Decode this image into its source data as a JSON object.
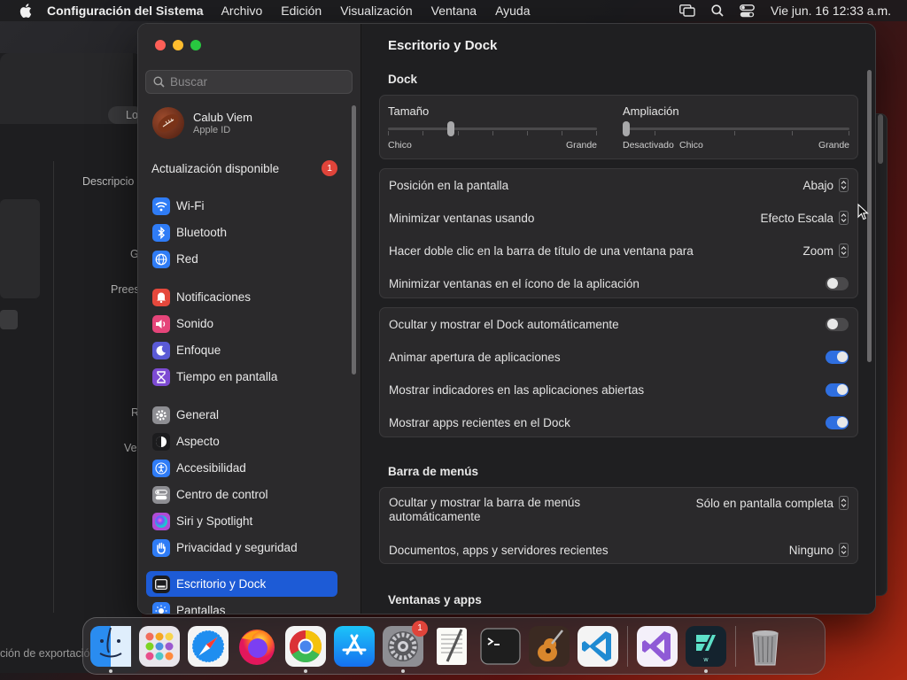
{
  "menubar": {
    "app_name": "Configuración del Sistema",
    "menus": [
      "Archivo",
      "Edición",
      "Visualización",
      "Ventana",
      "Ayuda"
    ],
    "datetime": "Vie jun. 16  12:33 a.m.",
    "icons": [
      "apple-logo-icon",
      "screen-mirroring-icon",
      "search-icon",
      "control-center-icon"
    ]
  },
  "background": {
    "texts": [
      "Lo",
      "Descripcio",
      "G",
      "Prees",
      "R",
      "Ve",
      "ción de exportació"
    ]
  },
  "sidebar": {
    "search_placeholder": "Buscar",
    "profile": {
      "name": "Calub Viem",
      "subtitle": "Apple ID"
    },
    "update": {
      "label": "Actualización disponible",
      "badge": "1"
    },
    "items": [
      {
        "label": "Wi-Fi",
        "icon": "wifi-icon",
        "color": "#2f7cf6"
      },
      {
        "label": "Bluetooth",
        "icon": "bluetooth-icon",
        "color": "#2f7cf6"
      },
      {
        "label": "Red",
        "icon": "globe-icon",
        "color": "#2f7cf6"
      },
      {
        "label": "Notificaciones",
        "icon": "bell-icon",
        "color": "#e5483c"
      },
      {
        "label": "Sonido",
        "icon": "speaker-icon",
        "color": "#e5457a"
      },
      {
        "label": "Enfoque",
        "icon": "moon-icon",
        "color": "#5a5ad6"
      },
      {
        "label": "Tiempo en pantalla",
        "icon": "hourglass-icon",
        "color": "#7d4bd3"
      },
      {
        "label": "General",
        "icon": "gear-icon",
        "color": "#8e8e93"
      },
      {
        "label": "Aspecto",
        "icon": "appearance-icon",
        "color": "#1c1c1e"
      },
      {
        "label": "Accesibilidad",
        "icon": "accessibility-icon",
        "color": "#2f7cf6"
      },
      {
        "label": "Centro de control",
        "icon": "control-center-icon",
        "color": "#8e8e93"
      },
      {
        "label": "Siri y Spotlight",
        "icon": "siri-icon",
        "color": "#b04bd6"
      },
      {
        "label": "Privacidad y seguridad",
        "icon": "hand-icon",
        "color": "#2f7cf6"
      },
      {
        "label": "Escritorio y Dock",
        "icon": "dock-icon",
        "color": "#1c1c1e",
        "active": true
      },
      {
        "label": "Pantallas",
        "icon": "sun-icon",
        "color": "#2f7cf6"
      }
    ]
  },
  "content": {
    "title": "Escritorio y Dock",
    "dock_section": "Dock",
    "size_slider": {
      "label": "Tamaño",
      "min_label": "Chico",
      "max_label": "Grande",
      "value": 0.3
    },
    "magnification_slider": {
      "label": "Ampliación",
      "off_label": "Desactivado",
      "min_label": "Chico",
      "max_label": "Grande",
      "value": 0.0
    },
    "dock_options": [
      {
        "label": "Posición en la pantalla",
        "value": "Abajo",
        "type": "popup"
      },
      {
        "label": "Minimizar ventanas usando",
        "value": "Efecto Escala",
        "type": "popup"
      },
      {
        "label": "Hacer doble clic en la barra de título de una ventana para",
        "value": "Zoom",
        "type": "popup"
      },
      {
        "label": "Minimizar ventanas en el ícono de la aplicación",
        "value": false,
        "type": "toggle"
      }
    ],
    "dock_toggles": [
      {
        "label": "Ocultar y mostrar el Dock automáticamente",
        "value": false
      },
      {
        "label": "Animar apertura de aplicaciones",
        "value": true
      },
      {
        "label": "Mostrar indicadores en las aplicaciones abiertas",
        "value": true
      },
      {
        "label": "Mostrar apps recientes en el Dock",
        "value": true
      }
    ],
    "menubar_section": "Barra de menús",
    "menubar_options": [
      {
        "label_line1": "Ocultar y mostrar la barra de menús",
        "label_line2": "automáticamente",
        "value": "Sólo en pantalla completa"
      },
      {
        "label": "Documentos, apps y servidores recientes",
        "value": "Ninguno"
      }
    ],
    "windows_section": "Ventanas y apps"
  },
  "dock": {
    "apps": [
      {
        "name": "Finder",
        "icon": "finder-icon",
        "running": true
      },
      {
        "name": "Launchpad",
        "icon": "launchpad-icon",
        "running": false
      },
      {
        "name": "Safari",
        "icon": "safari-icon",
        "running": false
      },
      {
        "name": "Firefox",
        "icon": "firefox-icon",
        "running": false
      },
      {
        "name": "Chrome",
        "icon": "chrome-icon",
        "running": true
      },
      {
        "name": "App Store",
        "icon": "app-store-icon",
        "running": false
      },
      {
        "name": "Configuración del Sistema",
        "icon": "system-settings-icon",
        "running": true,
        "badge": "1"
      },
      {
        "name": "TextEdit",
        "icon": "textedit-icon",
        "running": false
      },
      {
        "name": "Terminal",
        "icon": "terminal-icon",
        "running": false
      },
      {
        "name": "GarageBand",
        "icon": "garageband-icon",
        "running": false
      },
      {
        "name": "Visual Studio Code",
        "icon": "vscode-icon",
        "running": false
      }
    ],
    "recent_apps": [
      {
        "name": "Visual Studio",
        "icon": "visual-studio-icon",
        "running": false
      },
      {
        "name": "Wondershare",
        "icon": "filmora-icon",
        "running": true
      }
    ],
    "trash": {
      "name": "Papelera",
      "icon": "trash-icon"
    }
  }
}
